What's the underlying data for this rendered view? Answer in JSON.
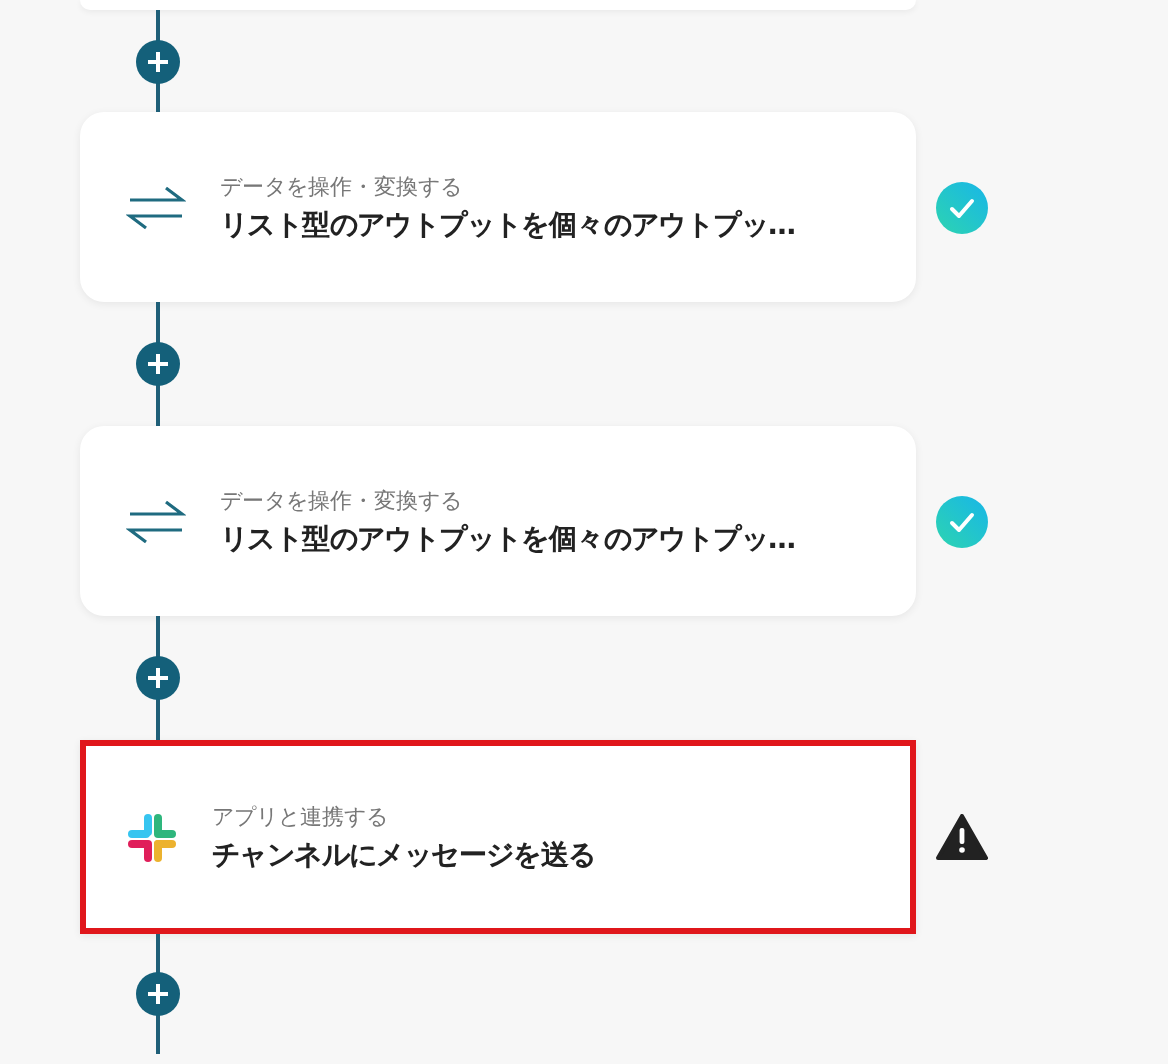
{
  "steps": [
    {
      "category": "データを操作・変換する",
      "title": "リスト型のアウトプットを個々のアウトプッ…",
      "kind": "transform",
      "complete": true,
      "selected": false
    },
    {
      "category": "データを操作・変換する",
      "title": "リスト型のアウトプットを個々のアウトプッ…",
      "kind": "transform",
      "complete": true,
      "selected": false
    },
    {
      "category": "アプリと連携する",
      "title": "チャンネルにメッセージを送る",
      "kind": "app",
      "complete": false,
      "selected": true
    }
  ]
}
